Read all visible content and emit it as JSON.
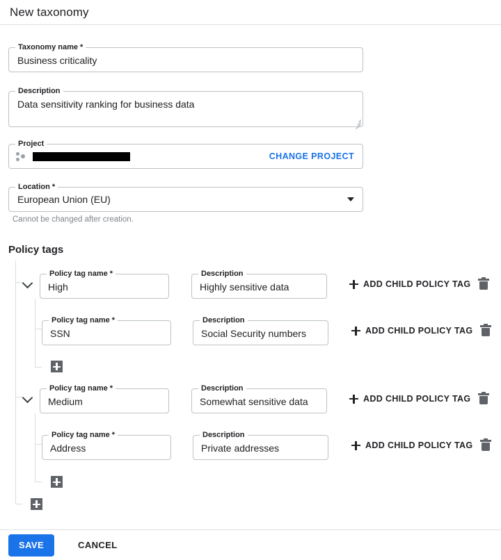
{
  "header": {
    "title": "New taxonomy"
  },
  "form": {
    "taxonomy_name": {
      "label": "Taxonomy name *",
      "value": "Business criticality"
    },
    "description": {
      "label": "Description",
      "value": "Data sensitivity ranking for business data"
    },
    "project": {
      "label": "Project",
      "value": "",
      "redacted": true,
      "change_label": "CHANGE PROJECT",
      "icon": "project-dots-icon"
    },
    "location": {
      "label": "Location *",
      "value": "European Union (EU)",
      "hint": "Cannot be changed after creation.",
      "caret_icon": "chevron-down-icon"
    }
  },
  "policy_tags": {
    "section_title": "Policy tags",
    "field_labels": {
      "name": "Policy tag name *",
      "description": "Description"
    },
    "add_child_label": "ADD CHILD POLICY TAG",
    "icons": {
      "expand": "chevron-down-icon",
      "delete": "trash-icon",
      "add": "plus-icon"
    },
    "rows": [
      {
        "level": 1,
        "name": "High",
        "description": "Highly sensitive data"
      },
      {
        "level": 2,
        "name": "SSN",
        "description": "Social Security numbers"
      },
      {
        "level": 1,
        "name": "Medium",
        "description": "Somewhat sensitive data"
      },
      {
        "level": 2,
        "name": "Address",
        "description": "Private addresses"
      }
    ]
  },
  "footer": {
    "save_label": "SAVE",
    "cancel_label": "CANCEL"
  },
  "colors": {
    "accent": "#1a73e8",
    "text": "#202124",
    "muted": "#80868b",
    "border": "#bdc1c6",
    "icon": "#5f6368"
  }
}
